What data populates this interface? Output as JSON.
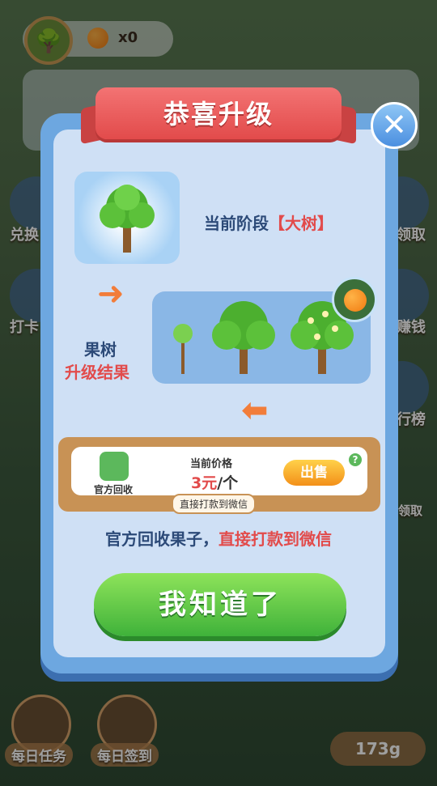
{
  "hud": {
    "fruit_count": "x0"
  },
  "side_buttons": {
    "left": [
      "兑换",
      "打卡"
    ],
    "right": [
      "领取",
      "赚钱",
      "行榜"
    ],
    "claim": "领取"
  },
  "bottom": {
    "tasks": "每日任务",
    "checkin": "每日签到",
    "water": "173g"
  },
  "modal": {
    "title": "恭喜升级",
    "stage_prefix": "当前阶段",
    "stage_value": "【大树】",
    "result_line1": "果树",
    "result_line2": "升级结果",
    "sell_card": {
      "logo_label": "官方回收",
      "price_title": "当前价格",
      "price_amount": "3元",
      "price_unit": "/个",
      "sell_label": "出售",
      "pay_note": "直接打款到微信"
    },
    "notice_prefix": "官方回收果子，",
    "notice_highlight": "直接打款到微信",
    "ok_label": "我知道了"
  },
  "colors": {
    "accent_red": "#e24b4b",
    "button_green": "#3fb23a",
    "modal_blue": "#6da7e0"
  }
}
